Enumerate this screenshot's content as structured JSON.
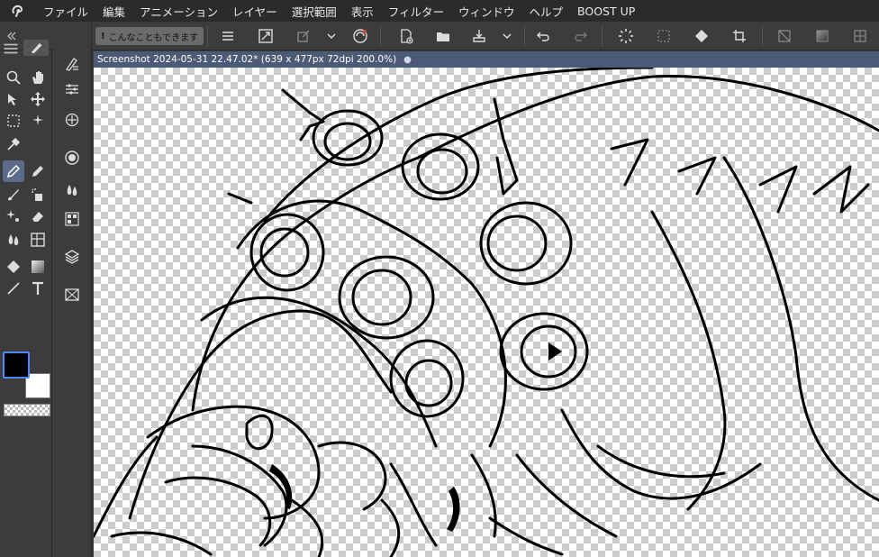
{
  "menubar": {
    "logo_icon": "clip-studio-logo-icon",
    "items": [
      "ファイル",
      "編集",
      "アニメーション",
      "レイヤー",
      "選択範囲",
      "表示",
      "フィルター",
      "ウィンドウ",
      "ヘルプ",
      "BOOST UP"
    ]
  },
  "commandbar": {
    "what_can_label": "こんなこともできます"
  },
  "canvas": {
    "tab_title": "Screenshot 2024-05-31 22.47.02* (639 x 477px 72dpi 200.0%)",
    "modified_dot": "●"
  },
  "colors": {
    "main": "#000000",
    "sub": "#ffffff",
    "accent": "#4b5a75",
    "active_tool": "#5b6b8a"
  }
}
